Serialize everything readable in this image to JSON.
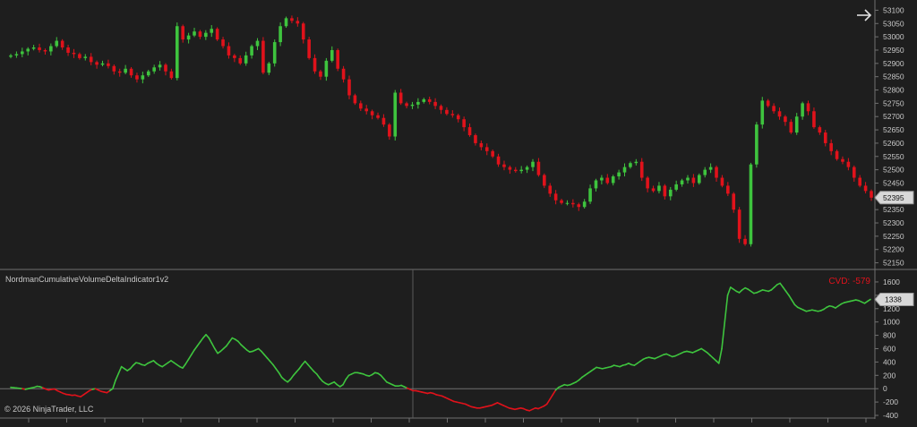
{
  "colors": {
    "background": "#1e1e1e",
    "up": "#3ec43e",
    "down": "#e0121b",
    "axis_text": "#c8c8c8",
    "grid": "#707070",
    "badge_bg": "#d8d8d8",
    "badge_text": "#111111",
    "cvd_label": "#e0121b"
  },
  "icons": {
    "navigate": "arrow-right-icon"
  },
  "labels": {
    "indicator_name": "NordmanCumulativeVolumeDeltaIndicator1v2",
    "copyright": "© 2026 NinjaTrader, LLC",
    "cvd": "CVD: -579"
  },
  "chart_data": [
    {
      "type": "candlestick",
      "ylim": [
        52125,
        53125
      ],
      "y_ticks": [
        52150,
        52200,
        52250,
        52300,
        52350,
        52400,
        52450,
        52500,
        52550,
        52600,
        52650,
        52700,
        52750,
        52800,
        52850,
        52900,
        52950,
        53000,
        53050,
        53100
      ],
      "last_price": "52395",
      "closes": [
        52930,
        52935,
        52945,
        52955,
        52960,
        52950,
        52945,
        52965,
        52985,
        52960,
        52940,
        52935,
        52920,
        52925,
        52905,
        52895,
        52900,
        52890,
        52870,
        52865,
        52880,
        52855,
        52840,
        52855,
        52870,
        52885,
        52895,
        52870,
        52845,
        53040,
        52990,
        53005,
        53020,
        53000,
        53015,
        53030,
        52990,
        52965,
        52930,
        52920,
        52900,
        52930,
        52965,
        52985,
        52865,
        52900,
        52980,
        53040,
        53070,
        53060,
        53050,
        52990,
        52920,
        52870,
        52850,
        52910,
        52950,
        52880,
        52840,
        52780,
        52750,
        52730,
        52720,
        52705,
        52695,
        52670,
        52625,
        52790,
        52750,
        52740,
        52745,
        52755,
        52765,
        52755,
        52740,
        52725,
        52710,
        52705,
        52690,
        52660,
        52630,
        52600,
        52585,
        52570,
        52550,
        52520,
        52510,
        52500,
        52495,
        52500,
        52510,
        52530,
        52480,
        52440,
        52410,
        52385,
        52375,
        52375,
        52370,
        52360,
        52380,
        52430,
        52460,
        52470,
        52450,
        52475,
        52490,
        52510,
        52525,
        52530,
        52470,
        52430,
        52420,
        52440,
        52400,
        52425,
        52445,
        52460,
        52470,
        52450,
        52480,
        52500,
        52510,
        52470,
        52440,
        52410,
        52350,
        52240,
        52220,
        52520,
        52670,
        52760,
        52740,
        52720,
        52700,
        52680,
        52640,
        52700,
        52750,
        52720,
        52660,
        52640,
        52600,
        52570,
        52540,
        52530,
        52510,
        52470,
        52440,
        52420,
        52395
      ]
    },
    {
      "type": "line",
      "ylim": [
        -440,
        1720
      ],
      "y_ticks": [
        -400,
        -200,
        0,
        200,
        400,
        600,
        800,
        1000,
        1200,
        1400,
        1600
      ],
      "last_value": "1338",
      "values": [
        20,
        15,
        10,
        5,
        0,
        -10,
        0,
        10,
        20,
        35,
        30,
        15,
        -5,
        -20,
        -10,
        -5,
        -30,
        -50,
        -70,
        -85,
        -90,
        -100,
        -95,
        -110,
        -120,
        -90,
        -60,
        -30,
        -10,
        0,
        -20,
        -40,
        -50,
        -60,
        -30,
        0,
        130,
        230,
        330,
        300,
        270,
        300,
        350,
        390,
        380,
        360,
        350,
        380,
        400,
        420,
        380,
        350,
        330,
        360,
        390,
        420,
        390,
        360,
        330,
        310,
        370,
        440,
        510,
        580,
        640,
        700,
        760,
        810,
        760,
        680,
        600,
        530,
        560,
        600,
        640,
        700,
        760,
        740,
        710,
        660,
        620,
        580,
        550,
        560,
        580,
        600,
        560,
        510,
        460,
        410,
        360,
        300,
        240,
        170,
        130,
        100,
        140,
        200,
        250,
        300,
        360,
        410,
        360,
        310,
        260,
        220,
        160,
        110,
        80,
        60,
        80,
        100,
        60,
        30,
        60,
        140,
        200,
        220,
        240,
        240,
        230,
        220,
        200,
        190,
        210,
        240,
        230,
        200,
        150,
        100,
        80,
        60,
        40,
        40,
        50,
        30,
        10,
        -10,
        -30,
        -30,
        -40,
        -50,
        -60,
        -70,
        -60,
        -70,
        -90,
        -100,
        -110,
        -130,
        -150,
        -170,
        -190,
        -200,
        -210,
        -220,
        -230,
        -250,
        -270,
        -280,
        -290,
        -290,
        -280,
        -270,
        -260,
        -250,
        -230,
        -210,
        -230,
        -250,
        -270,
        -290,
        -300,
        -310,
        -300,
        -290,
        -300,
        -320,
        -330,
        -310,
        -290,
        -300,
        -280,
        -260,
        -230,
        -160,
        -90,
        -20,
        20,
        40,
        60,
        50,
        60,
        80,
        100,
        130,
        170,
        200,
        230,
        260,
        290,
        320,
        310,
        300,
        310,
        320,
        330,
        350,
        340,
        330,
        350,
        360,
        380,
        360,
        350,
        380,
        410,
        440,
        460,
        470,
        460,
        450,
        470,
        490,
        510,
        520,
        500,
        480,
        490,
        510,
        530,
        550,
        560,
        550,
        540,
        560,
        580,
        600,
        570,
        540,
        500,
        460,
        420,
        380,
        600,
        1000,
        1400,
        1520,
        1490,
        1460,
        1440,
        1480,
        1510,
        1490,
        1460,
        1430,
        1440,
        1460,
        1480,
        1470,
        1460,
        1480,
        1520,
        1560,
        1580,
        1520,
        1460,
        1400,
        1330,
        1260,
        1220,
        1200,
        1180,
        1160,
        1170,
        1180,
        1170,
        1160,
        1170,
        1190,
        1220,
        1240,
        1230,
        1210,
        1240,
        1270,
        1290,
        1300,
        1310,
        1320,
        1330,
        1320,
        1300,
        1280,
        1310,
        1338
      ]
    }
  ]
}
